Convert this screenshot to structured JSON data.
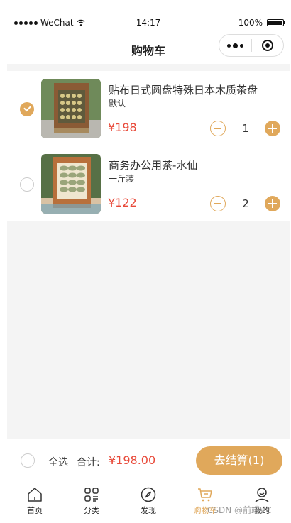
{
  "status": {
    "carrier": "WeChat",
    "time": "14:17",
    "battery": "100%"
  },
  "navbar": {
    "title": "购物车"
  },
  "items": [
    {
      "name": "贴布日式圆盘特殊日本木质茶盘",
      "spec": "默认",
      "price": "¥198",
      "qty": "1",
      "checked": true
    },
    {
      "name": "商务办公用茶-水仙",
      "spec": "一斤装",
      "price": "¥122",
      "qty": "2",
      "checked": false
    }
  ],
  "settle": {
    "select_all": "全选",
    "total_label": "合计:",
    "total_amount": "¥198.00",
    "checkout": "去结算(1)"
  },
  "tabbar": [
    {
      "label": "首页",
      "icon": "home-icon"
    },
    {
      "label": "分类",
      "icon": "category-icon"
    },
    {
      "label": "发现",
      "icon": "compass-icon"
    },
    {
      "label": "购物车",
      "icon": "cart-icon"
    },
    {
      "label": "我的",
      "icon": "user-icon"
    }
  ],
  "watermark": "CSDN @前端VC",
  "colors": {
    "accent": "#e0a85b",
    "price": "#e84a3a"
  }
}
